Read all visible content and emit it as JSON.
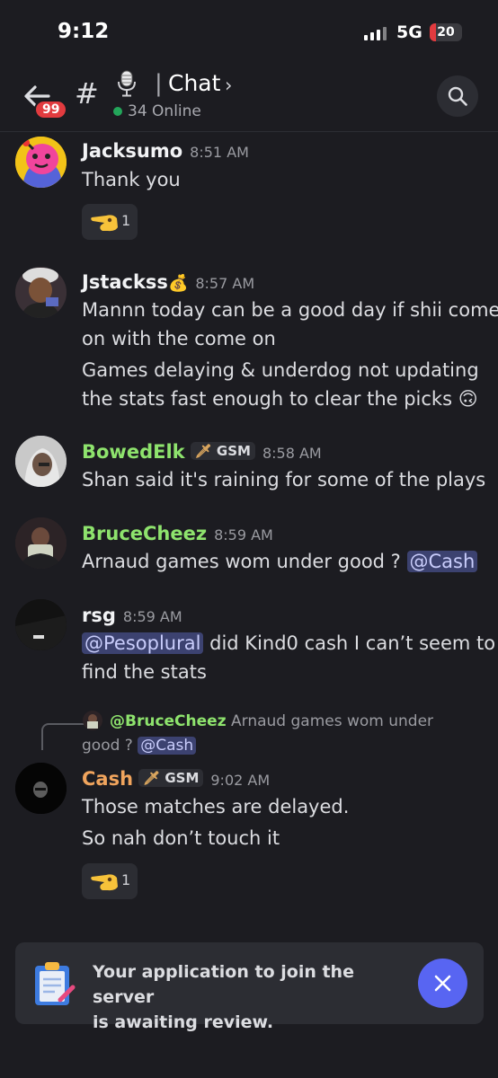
{
  "status_bar": {
    "time": "9:12",
    "network": "5G",
    "battery": "20",
    "battery_level": 0.2
  },
  "header": {
    "back_badge": "99",
    "channel_prefix": "#",
    "separator": "|",
    "channel_name": "Chat",
    "chevron": "›",
    "online": "34 Online",
    "icons": [
      "back-arrow-icon",
      "hash-icon",
      "microphone-icon",
      "chevron-right-icon",
      "search-icon"
    ]
  },
  "messages": [
    {
      "author": "Jacksumo",
      "time": "8:51 AM",
      "lines": [
        "Thank you"
      ],
      "reaction": {
        "emoji": "pointing-hand-emoji",
        "count": "1"
      }
    },
    {
      "author": "Jstackss",
      "author_emoji": "💰",
      "time": "8:57 AM",
      "lines": [
        "Mannn today can be a good day if shii come",
        "on with the come on",
        "Games delaying & underdog not updating",
        "the stats fast enough to clear the picks"
      ],
      "trailing_emoji": "🙃"
    },
    {
      "author": "BowedElk",
      "tag": "GSM",
      "time": "8:58 AM",
      "lines": [
        "Shan said it's raining for some of the plays"
      ]
    },
    {
      "author": "BruceCheez",
      "time": "8:59 AM",
      "text": "Arnaud games wom under good ?",
      "mention": "@Cash"
    },
    {
      "author": "rsg",
      "time": "8:59 AM",
      "mention": "@Pesoplural",
      "text_after": "did Kind0 cash I can’t seem to",
      "line2": "find the stats"
    },
    {
      "reply": {
        "author": "@BruceCheez",
        "text": "Arnaud games wom under",
        "text2": "good ?",
        "mention": "@Cash"
      },
      "author": "Cash",
      "tag": "GSM",
      "time": "9:02 AM",
      "lines": [
        "Those matches are delayed.",
        "So nah don’t touch it"
      ],
      "reaction": {
        "emoji": "pointing-hand-emoji",
        "count": "1"
      }
    }
  ],
  "banner": {
    "line1": "Your application to join the server",
    "line2": "is awaiting review.",
    "icon": "clipboard-icon",
    "close_icon": "close-icon"
  },
  "colors": {
    "background": "#1c1c21",
    "mention_bg": "#3c4270",
    "accent": "#5865f2",
    "green_name": "#8ee36d",
    "orange_name": "#f0a45d",
    "online": "#23a55a",
    "badge": "#e23b3f"
  }
}
